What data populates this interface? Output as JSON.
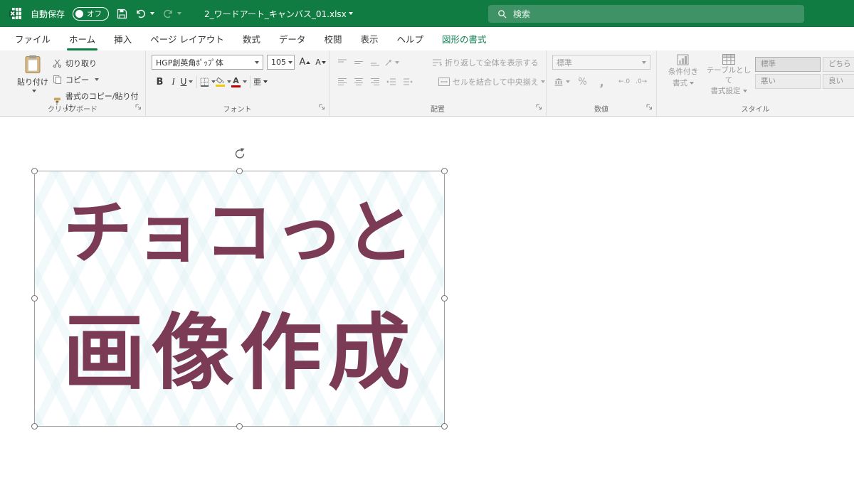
{
  "titlebar": {
    "autosave_label": "自動保存",
    "autosave_state": "オフ",
    "document_title": "2_ワードアート_キャンバス_01.xlsx",
    "search_placeholder": "検索"
  },
  "tabs": {
    "file": "ファイル",
    "home": "ホーム",
    "insert": "挿入",
    "page_layout": "ページ レイアウト",
    "formulas": "数式",
    "data": "データ",
    "review": "校閲",
    "view": "表示",
    "help": "ヘルプ",
    "shape_format": "図形の書式"
  },
  "clipboard": {
    "group_label": "クリップボード",
    "paste": "貼り付け",
    "cut": "切り取り",
    "copy": "コピー",
    "format_painter": "書式のコピー/貼り付け"
  },
  "font": {
    "group_label": "フォント",
    "font_name": "HGP創英角ﾎﾟｯﾌﾟ体",
    "font_size": "105",
    "grow": "A",
    "shrink": "A",
    "bold": "B",
    "italic": "I",
    "underline": "U",
    "ruby": "亜"
  },
  "alignment": {
    "group_label": "配置",
    "wrap_text": "折り返して全体を表示する",
    "merge_center": "セルを結合して中央揃え"
  },
  "number": {
    "group_label": "数値",
    "format": "標準",
    "percent": "%",
    "comma": ",",
    "increase_decimal": "←.0",
    "decrease_decimal": ".0→"
  },
  "styles": {
    "group_label": "スタイル",
    "conditional_line1": "条件付き",
    "conditional_line2": "書式",
    "table_line1": "テーブルとして",
    "table_line2": "書式設定",
    "cell_styles": [
      "標準",
      "どちら",
      "悪い",
      "良い"
    ]
  },
  "canvas": {
    "wordart_line1": "チョコっと",
    "wordart_line2": "画像作成"
  },
  "colors": {
    "titlebar_green": "#107c41",
    "search_green": "#3f9266",
    "wordart_text": "#7b3b54"
  }
}
